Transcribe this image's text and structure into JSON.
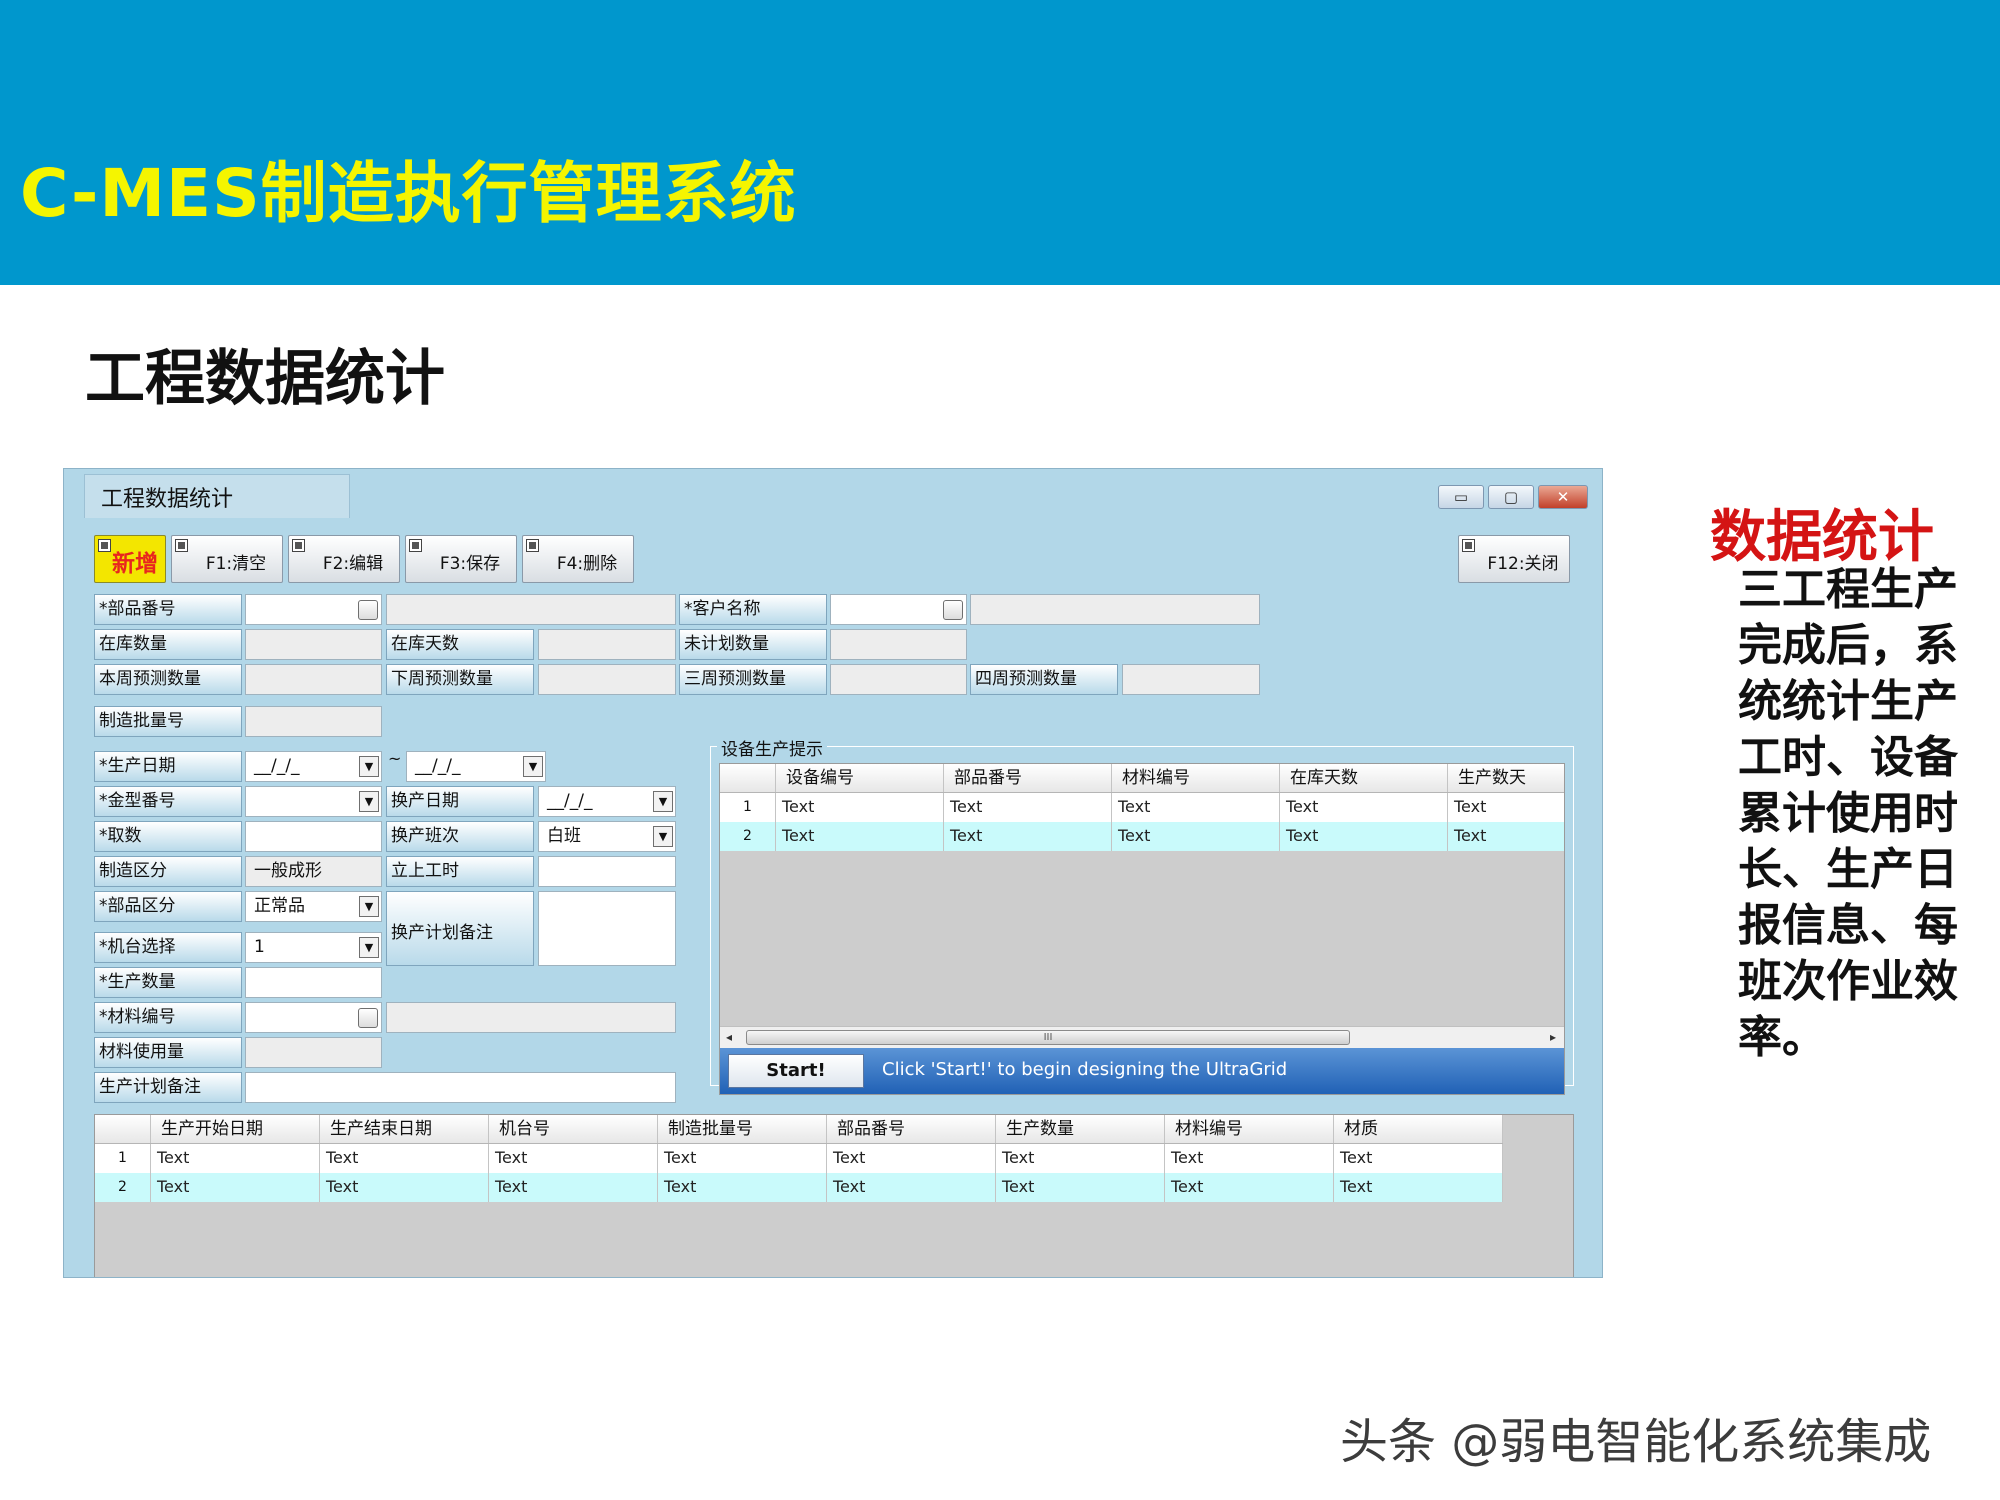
{
  "banner": {
    "title": "C-MES制造执行管理系统"
  },
  "section_title": "工程数据统计",
  "window": {
    "title": "工程数据统计",
    "controls": {
      "minimize": "▭",
      "maximize": "▢",
      "close": "✕"
    }
  },
  "toolbar": {
    "new_label": "新增",
    "clear_label": "F1:清空",
    "edit_label": "F2:编辑",
    "save_label": "F3:保存",
    "delete_label": "F4:删除",
    "close_label": "F12:关闭"
  },
  "form": {
    "part_no": "*部品番号",
    "customer_name": "*客户名称",
    "stock_qty": "在库数量",
    "stock_days": "在库天数",
    "unplanned_qty": "未计划数量",
    "this_week_forecast": "本周预测数量",
    "next_week_forecast": "下周预测数量",
    "three_week_forecast": "三周预测数量",
    "four_week_forecast": "四周预测数量",
    "batch_no": "制造批量号",
    "prod_date": "*生产日期",
    "date_placeholder": "__/_/_",
    "tilde": "~",
    "mold_no": "*金型番号",
    "change_date": "换产日期",
    "cavity": "*取数",
    "change_shift": "换产班次",
    "change_shift_value": "白班",
    "mfg_category": "制造区分",
    "mfg_category_value": "一般成形",
    "setup_hours": "立上工时",
    "part_category": "*部品区分",
    "part_category_value": "正常品",
    "change_plan_note": "换产计划备注",
    "machine_select": "*机台选择",
    "machine_value": "1",
    "prod_qty": "*生产数量",
    "material_no": "*材料编号",
    "material_usage": "材料使用量",
    "plan_note": "生产计划备注"
  },
  "equipment_grid": {
    "legend": "设备生产提示",
    "headers": [
      "设备编号",
      "部品番号",
      "材料编号",
      "在库天数",
      "生产数天"
    ],
    "rows": [
      {
        "num": "1",
        "cells": [
          "Text",
          "Text",
          "Text",
          "Text",
          "Text"
        ]
      },
      {
        "num": "2",
        "cells": [
          "Text",
          "Text",
          "Text",
          "Text",
          "Text"
        ]
      }
    ],
    "scroll_thumb": "III",
    "start_label": "Start!",
    "start_message": "Click 'Start!' to begin designing the UltraGrid"
  },
  "production_grid": {
    "headers": [
      "生产开始日期",
      "生产结束日期",
      "机台号",
      "制造批量号",
      "部品番号",
      "生产数量",
      "材料编号",
      "材质"
    ],
    "rows": [
      {
        "num": "1",
        "cells": [
          "Text",
          "Text",
          "Text",
          "Text",
          "Text",
          "Text",
          "Text",
          "Text"
        ]
      },
      {
        "num": "2",
        "cells": [
          "Text",
          "Text",
          "Text",
          "Text",
          "Text",
          "Text",
          "Text",
          "Text"
        ]
      }
    ]
  },
  "side_panel": {
    "title": "数据统计",
    "body": "三工程生产完成后，系统统计生产工时、设备累计使用时长、生产日报信息、每班次作业效率。"
  },
  "watermark": "头条 @弱电智能化系统集成"
}
